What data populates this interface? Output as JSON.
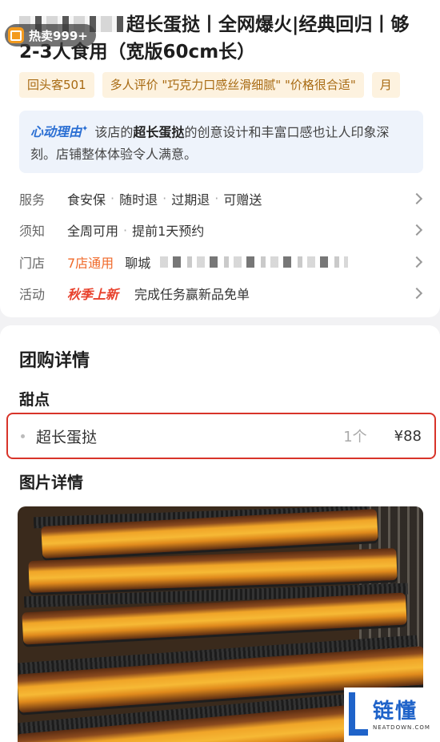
{
  "product": {
    "title": "超长蛋挞丨全网爆火|经典回归丨够2-3人食用（宽版60cm长）",
    "sold_badge": "热卖999+"
  },
  "tags": [
    "回头客501",
    "多人评价 \"巧克力口感丝滑细腻\" \"价格很合适\"",
    "月"
  ],
  "reason": {
    "label": "心动理由",
    "prefix": "该店的",
    "highlight": "超长蛋挞",
    "text": "的创意设计和丰富口感也让人印象深刻。店铺整体体验令人满意。"
  },
  "info_rows": {
    "service": {
      "label": "服务",
      "items": [
        "食安保",
        "随时退",
        "过期退",
        "可赠送"
      ]
    },
    "notice": {
      "label": "须知",
      "items": [
        "全周可用",
        "提前1天预约"
      ]
    },
    "store": {
      "label": "门店",
      "stores": "7店通用",
      "city": "聊城"
    },
    "activity": {
      "label": "活动",
      "badge": "秋季上新",
      "text": "完成任务赢新品免单"
    }
  },
  "detail": {
    "heading": "团购详情",
    "category": "甜点",
    "item": {
      "name": "超长蛋挞",
      "qty": "1个",
      "price": "¥88"
    },
    "images_heading": "图片详情"
  },
  "watermark": {
    "brand": "链懂",
    "site": "NEATDOWN.COM"
  },
  "colors": {
    "accent_orange": "#f06a2a",
    "highlight_red": "#d8342a",
    "reason_blue": "#2b6fd3",
    "tag_bg": "#fdf2df"
  }
}
